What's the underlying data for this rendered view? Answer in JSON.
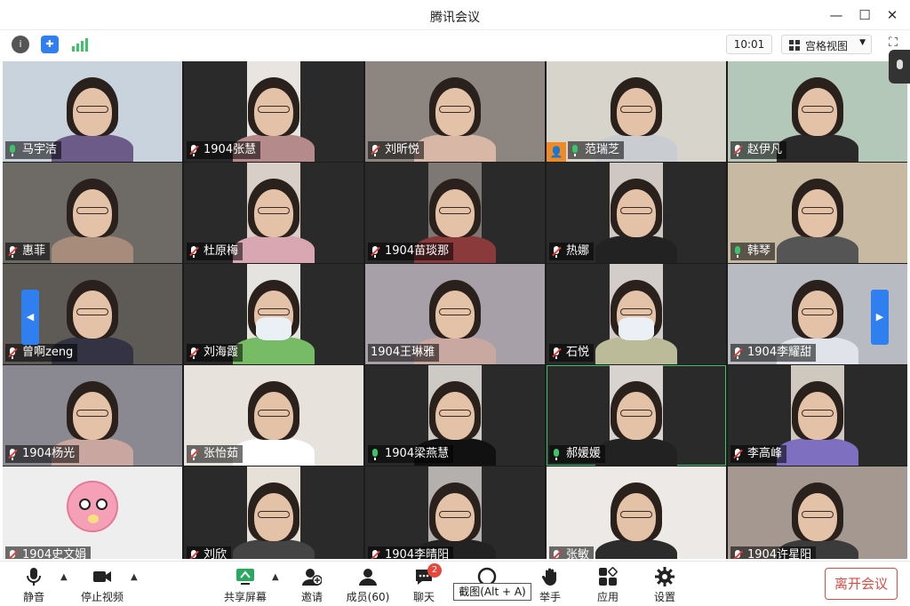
{
  "window": {
    "title": "腾讯会议"
  },
  "toolbar": {
    "time": "10:01",
    "view_mode": "宫格视图"
  },
  "participants": [
    {
      "name": "马宇洁",
      "mic": "on"
    },
    {
      "name": "1904张慧",
      "mic": "off"
    },
    {
      "name": "刘昕悦",
      "mic": "off"
    },
    {
      "name": "范瑞芝",
      "mic": "on"
    },
    {
      "name": "赵伊凡",
      "mic": "off"
    },
    {
      "name": "惠菲",
      "mic": "off"
    },
    {
      "name": "杜原梅",
      "mic": "off"
    },
    {
      "name": "1904苗琰那",
      "mic": "off"
    },
    {
      "name": "热娜",
      "mic": "off"
    },
    {
      "name": "韩琴",
      "mic": "on"
    },
    {
      "name": "曾啊zeng",
      "mic": "off"
    },
    {
      "name": "刘海霞",
      "mic": "off"
    },
    {
      "name": "1904王琳雅",
      "mic": "none"
    },
    {
      "name": "石悦",
      "mic": "off"
    },
    {
      "name": "1904李耀甜",
      "mic": "off"
    },
    {
      "name": "1904杨光",
      "mic": "off"
    },
    {
      "name": "张怡茹",
      "mic": "off"
    },
    {
      "name": "1904梁燕慧",
      "mic": "on"
    },
    {
      "name": "郝媛媛",
      "mic": "speaking"
    },
    {
      "name": "李高峰",
      "mic": "off"
    },
    {
      "name": "1904史文娟",
      "mic": "off"
    },
    {
      "name": "刘欣",
      "mic": "off"
    },
    {
      "name": "1904李晴阳",
      "mic": "off"
    },
    {
      "name": "张敏",
      "mic": "off"
    },
    {
      "name": "1904许星阳",
      "mic": "off"
    }
  ],
  "bottombar": {
    "mute": "静音",
    "stop_video": "停止视频",
    "share_screen": "共享屏幕",
    "invite": "邀请",
    "members": "成员(60)",
    "chat": "聊天",
    "chat_badge": "2",
    "screenshot": "截图(Alt + A)",
    "raise_hand": "举手",
    "apps": "应用",
    "settings": "设置",
    "leave": "离开会议"
  }
}
